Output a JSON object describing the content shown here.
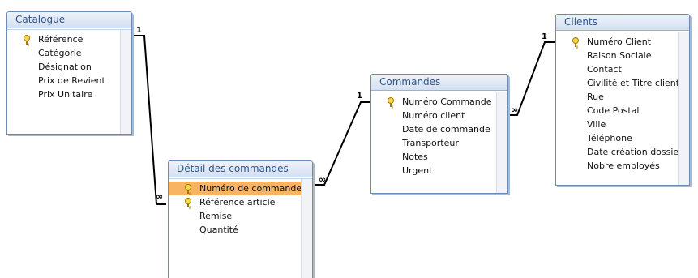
{
  "tables": {
    "catalogue": {
      "title": "Catalogue",
      "fields": [
        {
          "name": "Référence",
          "key": true,
          "selected": false
        },
        {
          "name": "Catégorie",
          "key": false,
          "selected": false
        },
        {
          "name": "Désignation",
          "key": false,
          "selected": false
        },
        {
          "name": "Prix de Revient",
          "key": false,
          "selected": false
        },
        {
          "name": "Prix Unitaire",
          "key": false,
          "selected": false
        }
      ]
    },
    "detail": {
      "title": "Détail des commandes",
      "fields": [
        {
          "name": "Numéro de commande",
          "key": true,
          "selected": true
        },
        {
          "name": "Référence article",
          "key": true,
          "selected": false
        },
        {
          "name": "Remise",
          "key": false,
          "selected": false
        },
        {
          "name": "Quantité",
          "key": false,
          "selected": false
        }
      ]
    },
    "commandes": {
      "title": "Commandes",
      "fields": [
        {
          "name": "Numéro Commande",
          "key": true,
          "selected": false
        },
        {
          "name": "Numéro client",
          "key": false,
          "selected": false
        },
        {
          "name": "Date de commande",
          "key": false,
          "selected": false
        },
        {
          "name": "Transporteur",
          "key": false,
          "selected": false
        },
        {
          "name": "Notes",
          "key": false,
          "selected": false
        },
        {
          "name": "Urgent",
          "key": false,
          "selected": false
        }
      ]
    },
    "clients": {
      "title": "Clients",
      "fields": [
        {
          "name": "Numéro Client",
          "key": true,
          "selected": false
        },
        {
          "name": "Raison Sociale",
          "key": false,
          "selected": false
        },
        {
          "name": "Contact",
          "key": false,
          "selected": false
        },
        {
          "name": "Civilité et Titre client",
          "key": false,
          "selected": false
        },
        {
          "name": "Rue",
          "key": false,
          "selected": false
        },
        {
          "name": "Code Postal",
          "key": false,
          "selected": false
        },
        {
          "name": "Ville",
          "key": false,
          "selected": false
        },
        {
          "name": "Téléphone",
          "key": false,
          "selected": false
        },
        {
          "name": "Date création dossier",
          "key": false,
          "selected": false
        },
        {
          "name": "Nobre employés",
          "key": false,
          "selected": false
        }
      ]
    }
  },
  "relationships": [
    {
      "one_table": "Catalogue",
      "one_label": "1",
      "many_table": "Détail des commandes",
      "many_label": "∞"
    },
    {
      "one_table": "Commandes",
      "one_label": "1",
      "many_table": "Détail des commandes",
      "many_label": "∞"
    },
    {
      "one_table": "Clients",
      "one_label": "1",
      "many_table": "Commandes",
      "many_label": "∞"
    }
  ],
  "colors": {
    "title_text": "#30558a",
    "border": "#6d8ab3",
    "selected_row": "#f8b463",
    "key_icon": "#f5d94a"
  }
}
